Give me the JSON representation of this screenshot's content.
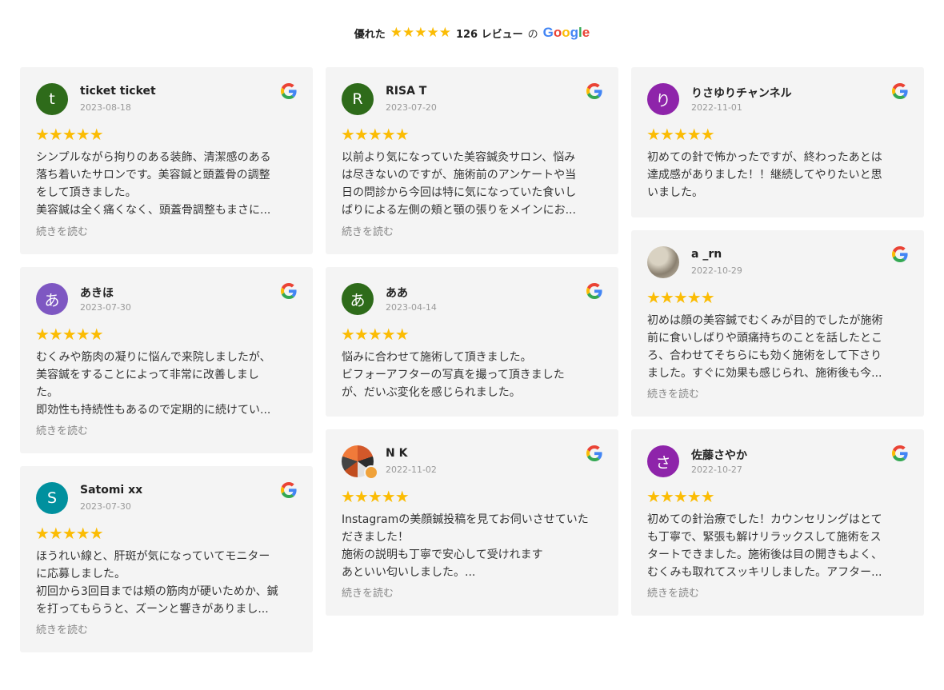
{
  "header": {
    "rating_label": "優れた",
    "stars": "★★★★★",
    "count_label": "126 レビュー",
    "of_label": "の",
    "google_letters": [
      "G",
      "o",
      "o",
      "g",
      "l",
      "e"
    ],
    "google_colors": [
      "#4285F4",
      "#EA4335",
      "#FBBC05",
      "#4285F4",
      "#34A853",
      "#EA4335"
    ]
  },
  "read_more": "続きを読む",
  "star_color": "#fbbc04",
  "reviews": [
    {
      "name": "ticket ticket",
      "date": "2023-08-18",
      "avatar_letter": "t",
      "avatar_color": "#2e6b1a",
      "stars": "★★★★★",
      "lines": [
        "シンプルながら拘りのある装飾、清潔感のある",
        "落ち着いたサロンです。美容鍼と頭蓋骨の調整",
        "をして頂きました。",
        "美容鍼は全く痛くなく、頭蓋骨調整もまさに..."
      ]
    },
    {
      "name": "RISA T",
      "date": "2023-07-20",
      "avatar_letter": "R",
      "avatar_color": "#2e6b1a",
      "stars": "★★★★★",
      "lines": [
        "以前より気になっていた美容鍼灸サロン、悩み",
        "は尽きないのですが、施術前のアンケートや当",
        "日の問診から今回は特に気になっていた食いし",
        "ばりによる左側の頬と顎の張りをメインにお..."
      ]
    },
    {
      "name": "りさゆりチャンネル",
      "date": "2022-11-01",
      "avatar_letter": "り",
      "avatar_color": "#8e24aa",
      "stars": "★★★★★",
      "lines": [
        "初めての針で怖かったですが、終わったあとは",
        "達成感がありました！！継続してやりたいと思",
        "いました。"
      ]
    },
    {
      "name": "あきほ",
      "date": "2023-07-30",
      "avatar_letter": "あ",
      "avatar_color": "#7e57c2",
      "stars": "★★★★★",
      "lines": [
        "むくみや筋肉の凝りに悩んで来院しましたが、",
        "美容鍼をすることによって非常に改善しまし",
        "た。",
        "即効性も持続性もあるので定期的に続けてい..."
      ]
    },
    {
      "name": "ああ",
      "date": "2023-04-14",
      "avatar_letter": "あ",
      "avatar_color": "#2e6b1a",
      "stars": "★★★★★",
      "lines": [
        "悩みに合わせて施術して頂きました。",
        "ビフォーアフターの写真を撮って頂きました",
        "が、だいぶ変化を感じられました。"
      ]
    },
    {
      "name": "a _rn",
      "date": "2022-10-29",
      "avatar_letter": "",
      "avatar_color": "#c8bfae",
      "stars": "★★★★★",
      "lines": [
        "初めは顔の美容鍼でむくみが目的でしたが施術",
        "前に食いしばりや頭痛持ちのことを話したとこ",
        "ろ、合わせてそちらにも効く施術をして下さり",
        "ました。すぐに効果も感じられ、施術後も今..."
      ]
    },
    {
      "name": "Satomi xx",
      "date": "2023-07-30",
      "avatar_letter": "S",
      "avatar_color": "#00909e",
      "stars": "★★★★★",
      "lines": [
        "ほうれい線と、肝斑が気になっていてモニター",
        "に応募しました。",
        "初回から3回目までは頬の筋肉が硬いためか、鍼",
        "を打ってもらうと、ズーンと響きがありまし..."
      ]
    },
    {
      "name": "N K",
      "date": "2022-11-02",
      "avatar_letter": "",
      "avatar_color": "#c14d1f",
      "stars": "★★★★★",
      "lines": [
        "Instagramの美顔鍼投稿を見てお伺いさせていた",
        "だきました！",
        "施術の説明も丁寧で安心して受けれます",
        "あといい匂いしました。..."
      ]
    },
    {
      "name": "佐藤さやか",
      "date": "2022-10-27",
      "avatar_letter": "さ",
      "avatar_color": "#8e24aa",
      "stars": "★★★★★",
      "lines": [
        "初めての針治療でした！カウンセリングはとて",
        "も丁寧で、緊張も解けリラックスして施術をス",
        "タートできました。施術後は目の開きもよく、",
        "むくみも取れてスッキリしました。アフター..."
      ]
    }
  ]
}
